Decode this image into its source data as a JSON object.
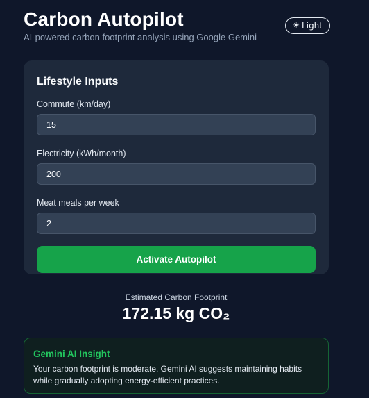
{
  "header": {
    "title": "Carbon Autopilot",
    "subtitle": "AI-powered carbon footprint analysis using Google Gemini",
    "theme_toggle": {
      "icon": "sun-icon",
      "glyph": "☀",
      "label": "Light"
    }
  },
  "form": {
    "title": "Lifestyle Inputs",
    "fields": [
      {
        "label": "Commute (km/day)",
        "value": "15"
      },
      {
        "label": "Electricity (kWh/month)",
        "value": "200"
      },
      {
        "label": "Meat meals per week",
        "value": "2"
      }
    ],
    "submit_label": "Activate Autopilot"
  },
  "result": {
    "label": "Estimated Carbon Footprint",
    "value": "172.15 kg CO₂"
  },
  "insight": {
    "title": "Gemini AI Insight",
    "text": "Your carbon footprint is moderate. Gemini AI suggests maintaining habits while gradually adopting energy-efficient practices."
  },
  "colors": {
    "background": "#0f172a",
    "card": "#1e293b",
    "input": "#334155",
    "accent_green": "#16a34a",
    "insight_title": "#22c55e",
    "insight_border": "#166534"
  }
}
